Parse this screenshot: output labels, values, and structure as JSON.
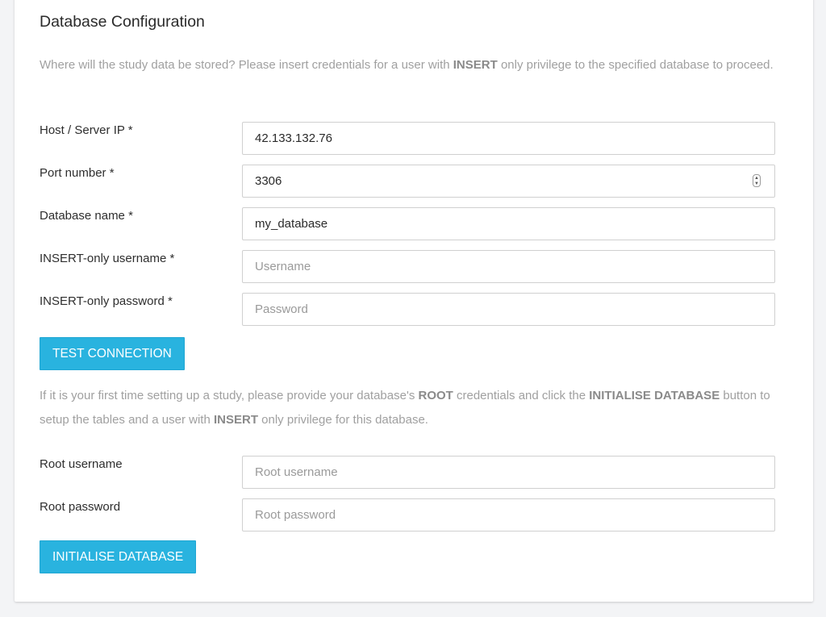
{
  "section": {
    "title": "Database Configuration",
    "help_prefix": "Where will the study data be stored? Please insert credentials for a user with ",
    "help_bold": "INSERT",
    "help_suffix": " only privilege to the specified database to proceed."
  },
  "fields": {
    "host": {
      "label": "Host / Server IP *",
      "value": "42.133.132.76",
      "placeholder": ""
    },
    "port": {
      "label": "Port number *",
      "value": "3306",
      "placeholder": ""
    },
    "dbname": {
      "label": "Database name *",
      "value": "my_database",
      "placeholder": ""
    },
    "username": {
      "label": "INSERT-only username *",
      "value": "",
      "placeholder": "Username"
    },
    "password": {
      "label": "INSERT-only password *",
      "value": "",
      "placeholder": "Password"
    }
  },
  "test_button": "TEST CONNECTION",
  "root_help": {
    "part1": "If it is your first time setting up a study, please provide your database's ",
    "bold1": "ROOT",
    "part2": " credentials and click the ",
    "bold2": "INITIALISE DATABASE",
    "part3": " button to setup the tables and a user with ",
    "bold3": "INSERT",
    "part4": " only privilege for this database."
  },
  "root_fields": {
    "username": {
      "label": "Root username",
      "value": "",
      "placeholder": "Root username"
    },
    "password": {
      "label": "Root password",
      "value": "",
      "placeholder": "Root password"
    }
  },
  "init_button": "INITIALISE DATABASE",
  "colors": {
    "accent": "#29b3df",
    "help_text": "#a0a0a0",
    "border": "#d0d0d0"
  }
}
